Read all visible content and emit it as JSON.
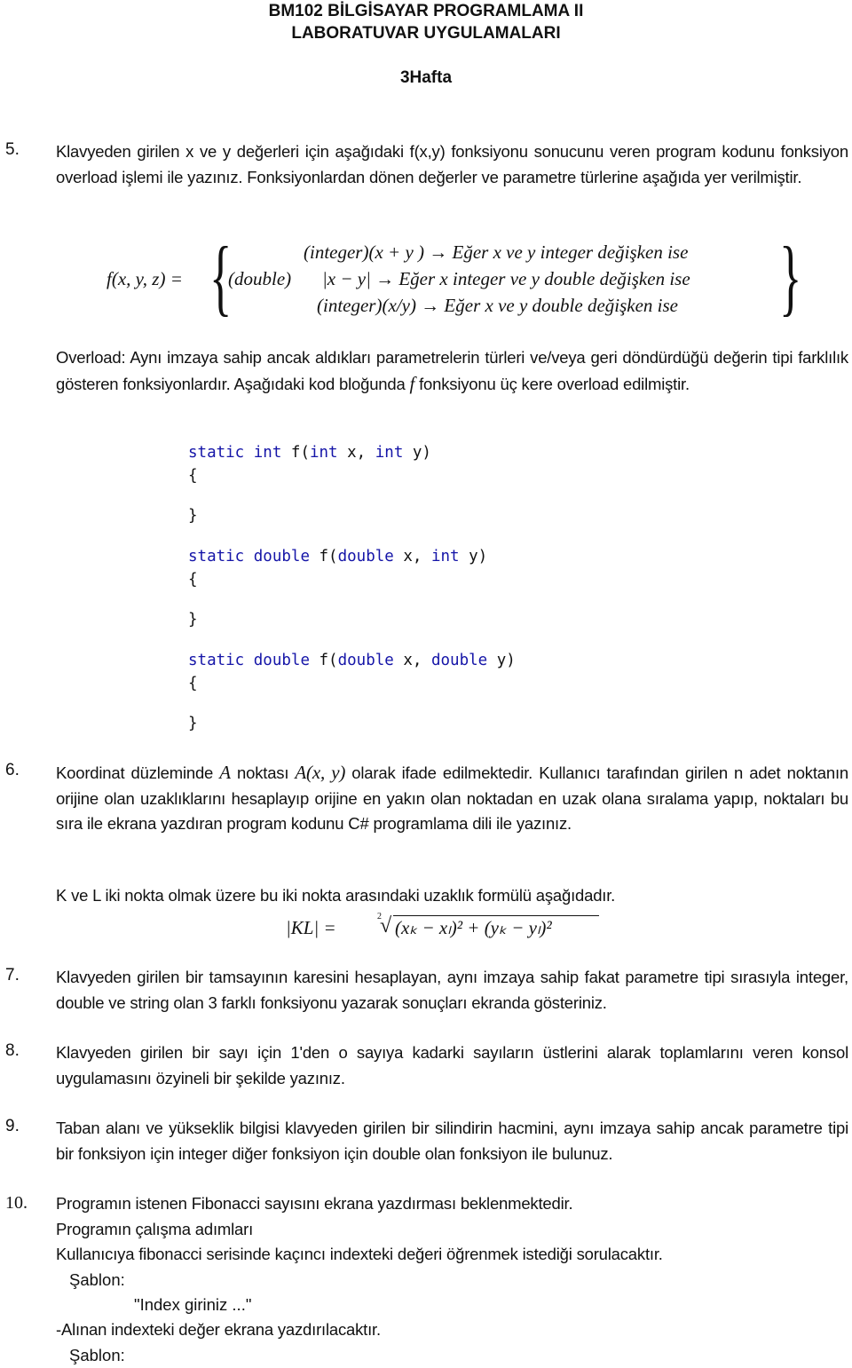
{
  "header": {
    "course_title": "BM102 BİLGİSAYAR PROGRAMLAMA II",
    "subtitle": "LABORATUVAR UYGULAMALARI",
    "week": "3Hafta"
  },
  "questions": {
    "q5": {
      "number": "5.",
      "text": "Klavyeden girilen x ve y değerleri için aşağıdaki f(x,y) fonksiyonu sonucunu veren program kodunu fonksiyon overload işlemi ile yazınız. Fonksiyonlardan dönen değerler ve parametre türlerine aşağıda yer verilmiştir.",
      "formula": {
        "lhs": "f(x, y, z) =",
        "prefix_double": "(double)",
        "cases": [
          "(integer)(x + y ) → Eğer x ve y integer değişken ise",
          "|x − y| → Eğer x integer ve y double değişken ise",
          "(integer)(x/y)  → Eğer x ve y double değişken ise"
        ]
      },
      "overload_text_1": "Overload: Aynı imzaya sahip ancak aldıkları parametrelerin türleri ve/veya geri döndürdüğü değerin tipi farklılık gösteren fonksiyonlardır. Aşağıdaki kod bloğunda ",
      "overload_f": "f",
      "overload_text_2": " fonksiyonu üç kere overload edilmiştir.",
      "code_blocks": [
        {
          "kw1": "static",
          "ret": "int",
          "name": " f(",
          "p1type": "int",
          "p1": " x, ",
          "p2type": "int",
          "p2": " y)",
          "open": "{",
          "close": "}"
        },
        {
          "kw1": "static",
          "ret": "double",
          "name": " f(",
          "p1type": "double",
          "p1": " x, ",
          "p2type": "int",
          "p2": " y)",
          "open": "{",
          "close": "}"
        },
        {
          "kw1": "static",
          "ret": "double",
          "name": " f(",
          "p1type": "double",
          "p1": " x, ",
          "p2type": "double",
          "p2": " y)",
          "open": "{",
          "close": "}"
        }
      ]
    },
    "q6": {
      "number": "6.",
      "text_a": "Koordinat düzleminde ",
      "A": "A",
      "text_b": " noktası ",
      "Axy": "A(x, y)",
      "text_c": " olarak ifade edilmektedir. Kullanıcı tarafından girilen n adet noktanın orijine olan uzaklıklarını hesaplayıp orijine en yakın olan noktadan en uzak olana sıralama yapıp, noktaları bu sıra ile ekrana yazdıran program kodunu C# programlama dili ile yazınız.",
      "distance_intro": "K ve L iki nokta olmak üzere bu iki nokta arasındaki uzaklık formülü aşağıdadır.",
      "distance_lhs": "|KL| =",
      "root_index": "2",
      "distance_rhs": "(xₖ − xₗ)² + (yₖ − yₗ)²"
    },
    "q7": {
      "number": "7.",
      "text": "Klavyeden girilen bir tamsayının karesini hesaplayan, aynı imzaya sahip fakat parametre tipi sırasıyla integer, double ve string olan 3 farklı fonksiyonu yazarak sonuçları ekranda gösteriniz."
    },
    "q8": {
      "number": "8.",
      "text": "Klavyeden girilen bir sayı için 1'den o sayıya kadarki sayıların üstlerini alarak toplamlarını veren konsol uygulamasını özyineli bir şekilde yazınız."
    },
    "q9": {
      "number": "9.",
      "text": "Taban alanı ve yükseklik bilgisi klavyeden girilen bir silindirin hacmini, aynı imzaya sahip ancak parametre tipi bir fonksiyon için integer diğer fonksiyon için double olan fonksiyon ile bulunuz."
    },
    "q10": {
      "number": "10.",
      "lines": [
        "Programın istenen Fibonacci sayısını ekrana yazdırması beklenmektedir.",
        "Programın çalışma adımları",
        "Kullanıcıya fibonacci serisinde kaçıncı indexteki değeri öğrenmek istediği sorulacaktır."
      ],
      "template_label_1": "Şablon:",
      "template_value_1": "\"Index giriniz ...\"",
      "step_2": "-Alınan indexteki değer ekrana yazdırılacaktır.",
      "template_label_2": "Şablon:"
    }
  }
}
